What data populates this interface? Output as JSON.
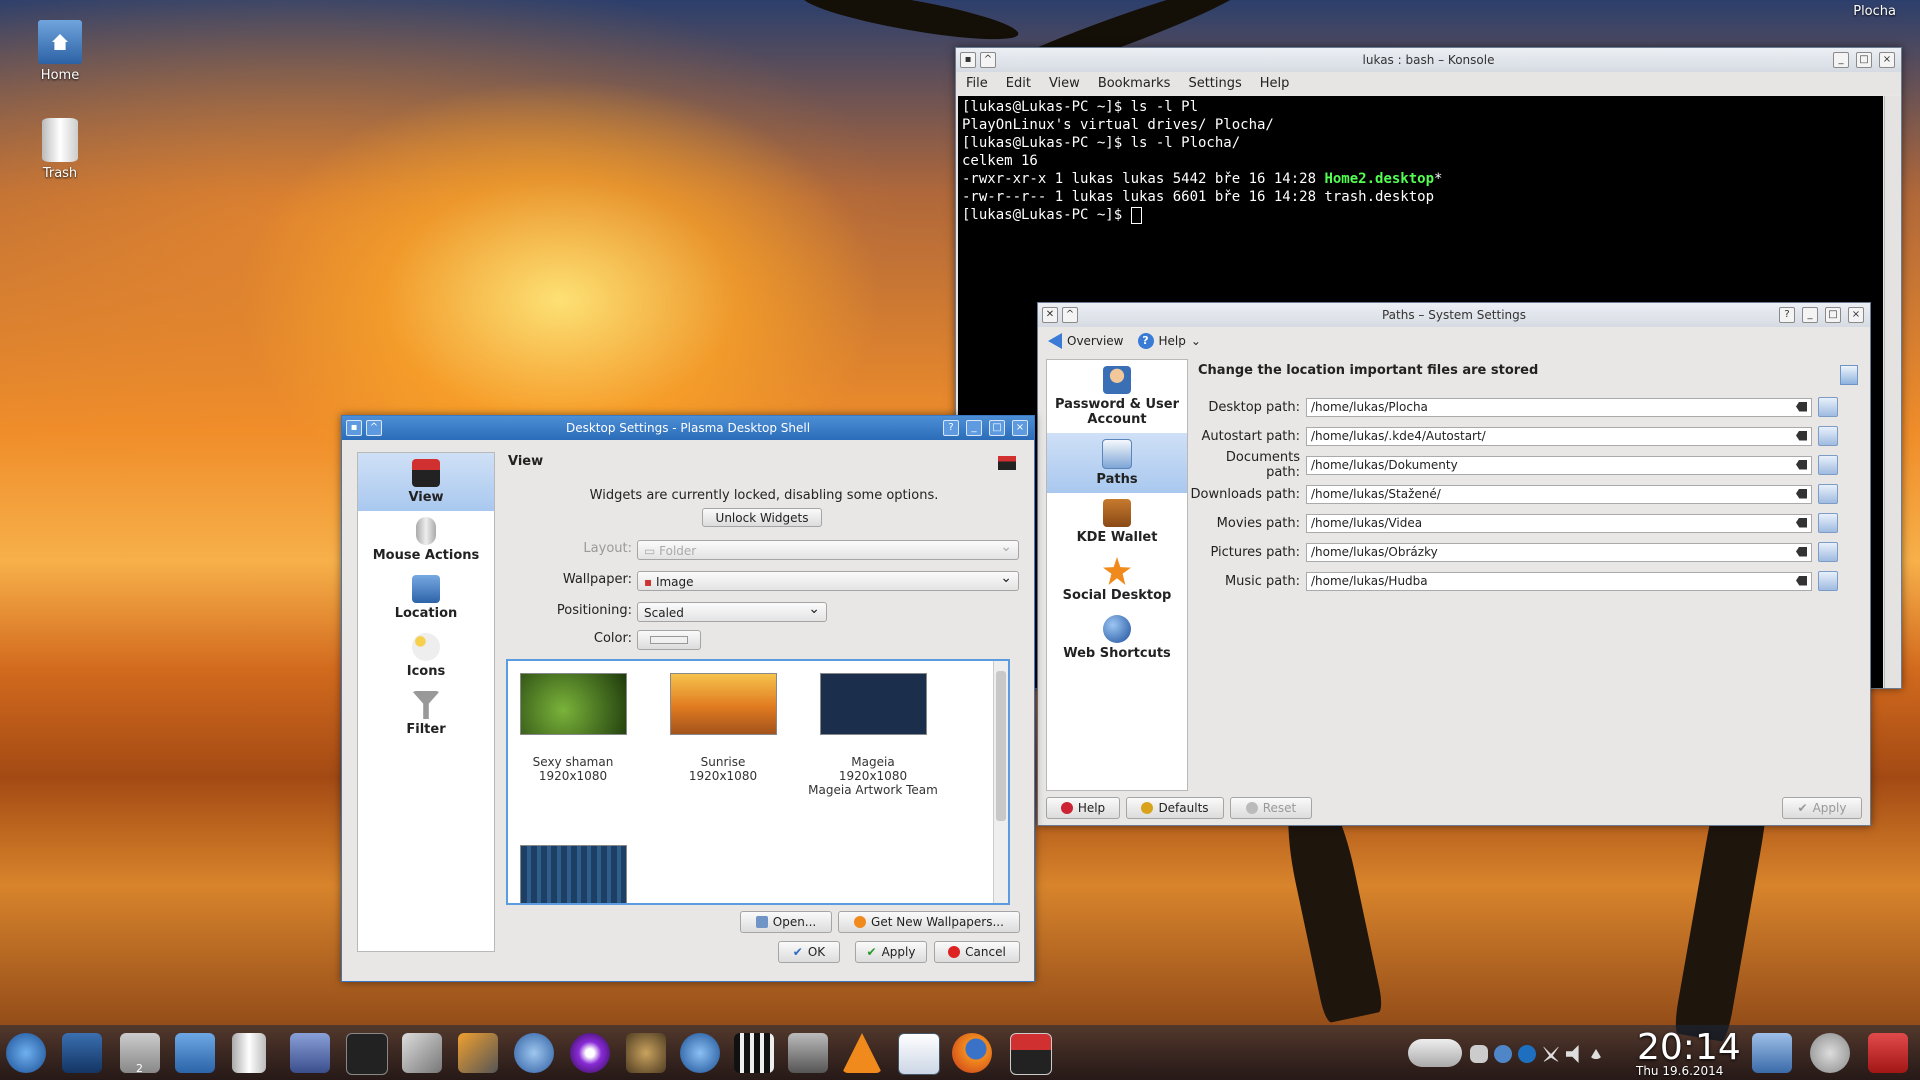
{
  "desktop": {
    "top_right_label": "Plocha",
    "icons": [
      {
        "label": "Home",
        "icon": "home-folder-icon"
      },
      {
        "label": "Trash",
        "icon": "trash-icon"
      }
    ]
  },
  "konsole": {
    "title": "lukas : bash – Konsole",
    "menu": [
      "File",
      "Edit",
      "View",
      "Bookmarks",
      "Settings",
      "Help"
    ],
    "lines": [
      "[lukas@Lukas-PC ~]$ ls -l Pl",
      "PlayOnLinux's virtual drives/ Plocha/",
      "[lukas@Lukas-PC ~]$ ls -l Plocha/",
      "celkem 16"
    ],
    "ls_line1_prefix": "-rwxr-xr-x 1 lukas lukas 5442 bře 16 14:28 ",
    "ls_line1_file": "Home2.desktop",
    "ls_line1_suffix": "*",
    "ls_line2": "-rw-r--r-- 1 lukas lukas 6601 bře 16 14:28 trash.desktop",
    "prompt": "[lukas@Lukas-PC ~]$ "
  },
  "system_settings": {
    "title": "Paths – System Settings",
    "toolbar": {
      "overview": "Overview",
      "help": "Help"
    },
    "sidebar": [
      {
        "label": "Password & User Account",
        "icon": "user-account-icon"
      },
      {
        "label": "Paths",
        "icon": "paths-icon",
        "selected": true
      },
      {
        "label": "KDE Wallet",
        "icon": "wallet-icon"
      },
      {
        "label": "Social Desktop",
        "icon": "star-icon"
      },
      {
        "label": "Web Shortcuts",
        "icon": "globe-icon"
      }
    ],
    "heading": "Change the location important files are stored",
    "paths": [
      {
        "label": "Desktop path:",
        "value": "/home/lukas/Plocha"
      },
      {
        "label": "Autostart path:",
        "value": "/home/lukas/.kde4/Autostart/"
      },
      {
        "label": "Documents path:",
        "value": "/home/lukas/Dokumenty"
      },
      {
        "label": "Downloads path:",
        "value": "/home/lukas/Stažené/"
      },
      {
        "label": "Movies path:",
        "value": "/home/lukas/Videa"
      },
      {
        "label": "Pictures path:",
        "value": "/home/lukas/Obrázky"
      },
      {
        "label": "Music path:",
        "value": "/home/lukas/Hudba"
      }
    ],
    "buttons": {
      "help": "Help",
      "defaults": "Defaults",
      "reset": "Reset",
      "apply": "Apply"
    }
  },
  "desktop_settings": {
    "title": "Desktop Settings - Plasma Desktop Shell",
    "sidebar": [
      {
        "label": "View",
        "icon": "view-icon",
        "selected": true
      },
      {
        "label": "Mouse Actions",
        "icon": "mouse-icon"
      },
      {
        "label": "Location",
        "icon": "location-folder-icon"
      },
      {
        "label": "Icons",
        "icon": "icons-icon"
      },
      {
        "label": "Filter",
        "icon": "filter-icon"
      }
    ],
    "section": "View",
    "locked_msg": "Widgets are currently locked, disabling some options.",
    "unlock_btn": "Unlock Widgets",
    "layout_label": "Layout:",
    "layout_value": "Folder",
    "wallpaper_label": "Wallpaper:",
    "wallpaper_value": "Image",
    "positioning_label": "Positioning:",
    "positioning_value": "Scaled",
    "color_label": "Color:",
    "wallpapers": [
      {
        "name": "Sexy shaman",
        "size": "1920x1080",
        "author": "",
        "color": "#2f5a18"
      },
      {
        "name": "Sunrise",
        "size": "1920x1080",
        "author": "",
        "color": "#e48a30"
      },
      {
        "name": "Mageia",
        "size": "1920x1080",
        "author": "Mageia Artwork Team",
        "color": "#1b2e4c"
      },
      {
        "name": "",
        "size": "",
        "author": "",
        "color": "#23496f"
      }
    ],
    "buttons": {
      "open": "Open...",
      "get_new": "Get New Wallpapers...",
      "ok": "OK",
      "apply": "Apply",
      "cancel": "Cancel"
    }
  },
  "taskbar": {
    "clock": "20:14",
    "date": "Thu 19.6.2014",
    "badge": "2"
  }
}
